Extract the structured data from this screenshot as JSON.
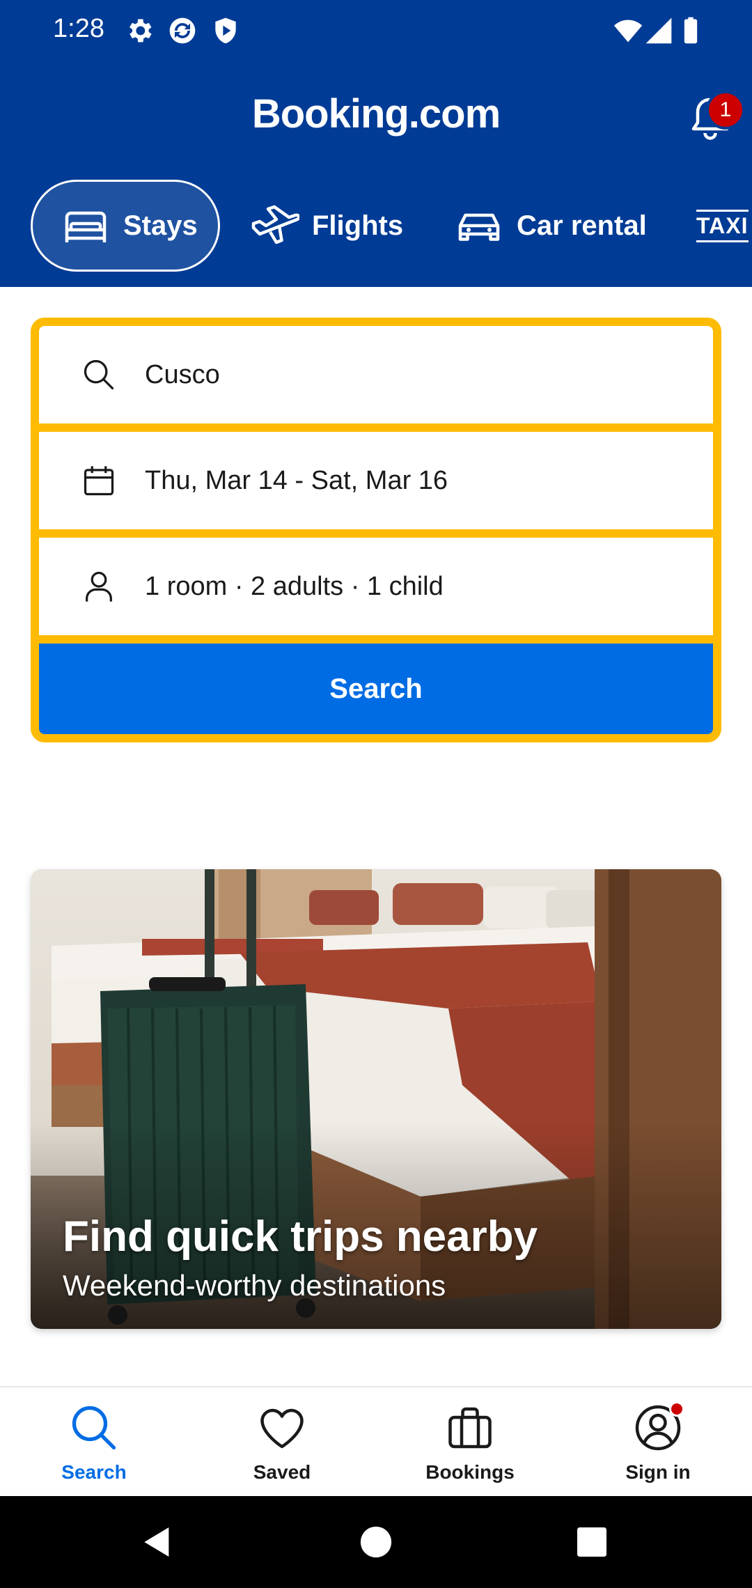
{
  "status_bar": {
    "time": "1:28",
    "icons": [
      "gear-icon",
      "sync-icon",
      "shield-icon",
      "wifi-icon",
      "signal-icon",
      "battery-icon"
    ]
  },
  "app_bar": {
    "brand": "Booking.com",
    "notification_count": "1"
  },
  "tabs": [
    {
      "label": "Stays",
      "icon": "bed-icon",
      "active": true
    },
    {
      "label": "Flights",
      "icon": "plane-icon",
      "active": false
    },
    {
      "label": "Car rental",
      "icon": "car-icon",
      "active": false
    },
    {
      "label": "TAXI",
      "icon": "taxi-icon",
      "active": false
    }
  ],
  "search": {
    "destination": "Cusco",
    "dates": "Thu, Mar 14 - Sat, Mar 16",
    "guests": "1 room · 2 adults · 1 child",
    "button_label": "Search"
  },
  "promo": {
    "title": "Find quick trips nearby",
    "subtitle": "Weekend-worthy destinations"
  },
  "bottom_nav": [
    {
      "label": "Search",
      "icon": "search-icon",
      "active": true
    },
    {
      "label": "Saved",
      "icon": "heart-icon",
      "active": false
    },
    {
      "label": "Bookings",
      "icon": "briefcase-icon",
      "active": false
    },
    {
      "label": "Sign in",
      "icon": "account-icon",
      "active": false
    }
  ],
  "colors": {
    "header_bg": "#003b95",
    "accent_yellow": "#febb02",
    "primary_blue": "#006ce4",
    "badge_red": "#cc0000"
  }
}
